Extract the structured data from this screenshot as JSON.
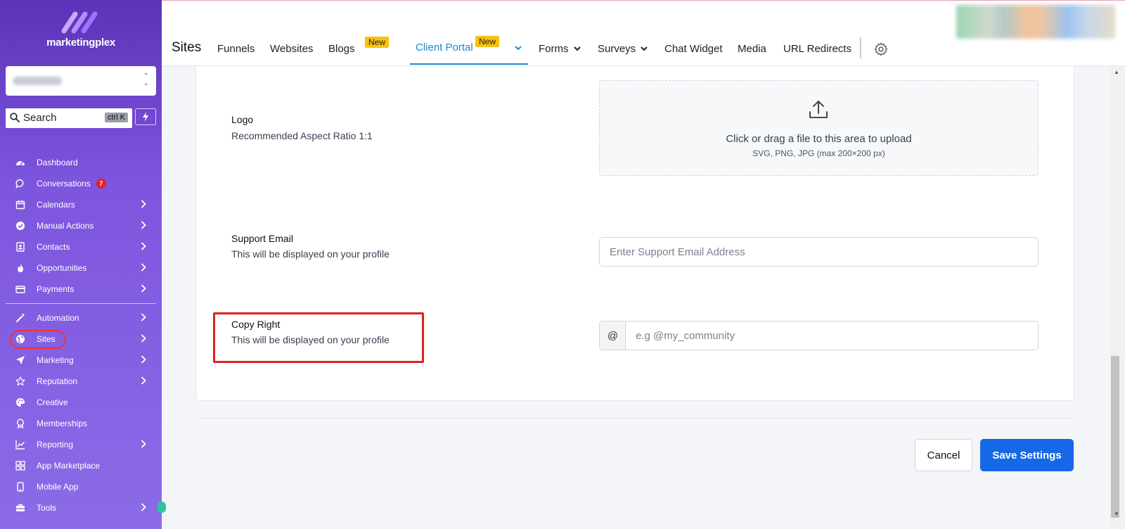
{
  "brand": {
    "name": "marketingplex"
  },
  "sidebar": {
    "search": {
      "label": "Search",
      "shortcut": "ctrl K"
    },
    "nav": [
      {
        "label": "Dashboard",
        "icon": "dashboard-icon"
      },
      {
        "label": "Conversations",
        "icon": "chat-icon",
        "badge": "7"
      },
      {
        "label": "Calendars",
        "icon": "calendar-icon",
        "chevron": true
      },
      {
        "label": "Manual Actions",
        "icon": "check-circle-icon",
        "chevron": true
      },
      {
        "label": "Contacts",
        "icon": "contacts-icon",
        "chevron": true
      },
      {
        "label": "Opportunities",
        "icon": "flame-icon",
        "chevron": true
      },
      {
        "label": "Payments",
        "icon": "card-icon",
        "chevron": true
      },
      {
        "label": "Automation",
        "icon": "magic-wand-icon",
        "chevron": true
      },
      {
        "label": "Sites",
        "icon": "globe-icon",
        "chevron": true
      },
      {
        "label": "Marketing",
        "icon": "send-icon",
        "chevron": true
      },
      {
        "label": "Reputation",
        "icon": "star-icon",
        "chevron": true
      },
      {
        "label": "Creative",
        "icon": "palette-icon"
      },
      {
        "label": "Memberships",
        "icon": "award-icon"
      },
      {
        "label": "Reporting",
        "icon": "chart-icon",
        "chevron": true
      },
      {
        "label": "App Marketplace",
        "icon": "grid-icon"
      },
      {
        "label": "Mobile App",
        "icon": "phone-icon"
      },
      {
        "label": "Tools",
        "icon": "toolbox-icon",
        "chevron": true
      }
    ]
  },
  "topbar": {
    "title": "Sites",
    "tabs": [
      {
        "label": "Funnels"
      },
      {
        "label": "Websites"
      },
      {
        "label": "Blogs",
        "badge": "New"
      },
      {
        "label": "Client Portal",
        "badge": "New",
        "active": true
      },
      {
        "label": "Forms"
      },
      {
        "label": "Surveys"
      },
      {
        "label": "Chat Widget"
      },
      {
        "label": "Media"
      },
      {
        "label": "URL Redirects"
      }
    ]
  },
  "form": {
    "logo": {
      "label": "Logo",
      "description": "Recommended Aspect Ratio 1:1",
      "upload_main": "Click or drag a file to this area to upload",
      "upload_sub": "SVG, PNG, JPG (max 200×200 px)"
    },
    "support_email": {
      "label": "Support Email",
      "description": "This will be displayed on your profile",
      "placeholder": "Enter Support Email Address",
      "value": ""
    },
    "copyright": {
      "label": "Copy Right",
      "description": "This will be displayed on your profile",
      "prefix": "@",
      "placeholder": "e.g @my_community",
      "value": ""
    }
  },
  "actions": {
    "cancel": "Cancel",
    "save": "Save Settings"
  },
  "colors": {
    "accent": "#1a8ad4",
    "primary_button": "#1668e6",
    "badge_new": "#f5c211",
    "highlight": "#e02020",
    "sidebar_top": "#5b33b8",
    "sidebar_bottom": "#8b6be8"
  }
}
